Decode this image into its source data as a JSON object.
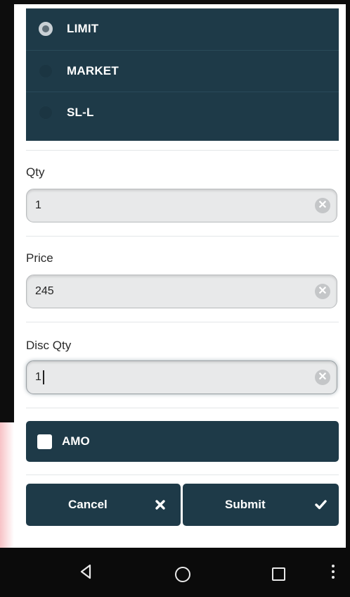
{
  "order_types": [
    {
      "label": "LIMIT",
      "selected": true
    },
    {
      "label": "MARKET",
      "selected": false
    },
    {
      "label": "SL-L",
      "selected": false
    }
  ],
  "fields": {
    "qty": {
      "label": "Qty",
      "value": "1"
    },
    "price": {
      "label": "Price",
      "value": "245"
    },
    "disc_qty": {
      "label": "Disc Qty",
      "value": "1"
    }
  },
  "amo": {
    "label": "AMO",
    "checked": false
  },
  "buttons": {
    "cancel": {
      "label": "Cancel",
      "icon": "close-icon"
    },
    "submit": {
      "label": "Submit",
      "icon": "checkmark-icon"
    }
  },
  "navbar": {
    "icons": [
      "back-icon",
      "home-icon",
      "recents-icon",
      "overflow-menu-icon"
    ]
  },
  "colors": {
    "panel": "#1e3a48",
    "field_bg": "#e8e9ea",
    "background": "#ffffff"
  }
}
